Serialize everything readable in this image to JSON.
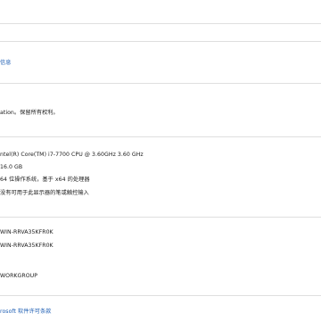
{
  "support_link": "信息",
  "copyright": "ation。保留所有权利。",
  "specs": {
    "processor": "ntel(R) Core(TM) i7-7700 CPU @ 3.60GHz   3.60 GHz",
    "ram": "16.0 GB",
    "system_type": "64 位操作系统，基于 x64 的处理器",
    "pen_touch": "没有可用于此显示器的笔或触控输入"
  },
  "computer": {
    "name": "WIN-RRVA35KFR0K",
    "full_name": "WIN-RRVA35KFR0K",
    "workgroup": "WORKGROUP"
  },
  "license_link": "rosoft 软件许可条款"
}
